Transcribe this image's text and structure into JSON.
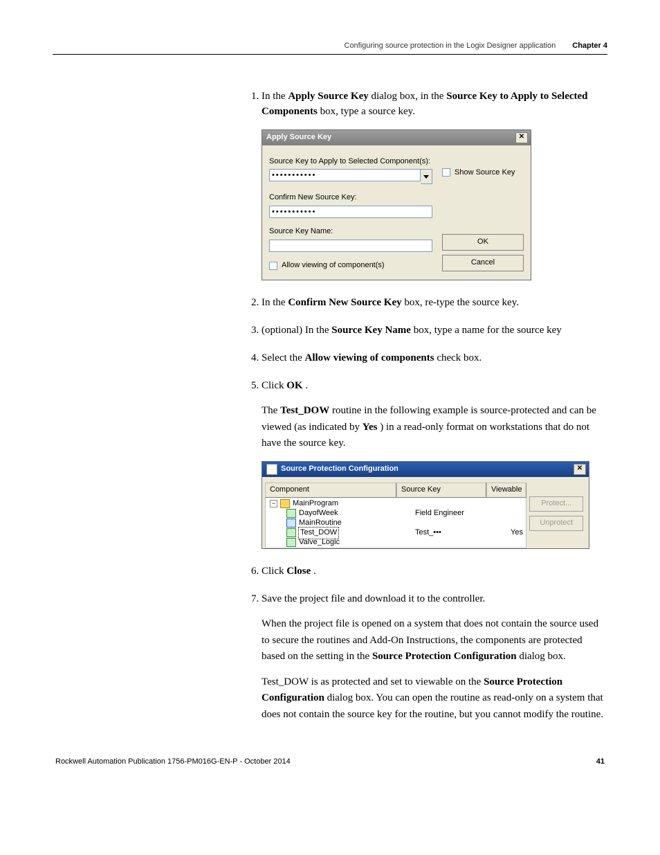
{
  "header": {
    "title": "Configuring source protection in the Logix Designer application",
    "chapter": "Chapter 4"
  },
  "steps": {
    "s1": {
      "pre": "In the ",
      "b1": "Apply Source Key",
      "mid1": " dialog box, in the ",
      "b2": "Source Key to Apply to Selected Components",
      "post": " box, type a source key."
    },
    "s2": {
      "pre": "In the ",
      "b1": "Confirm New Source Key",
      "post": " box, re-type the source key."
    },
    "s3": {
      "pre": "(optional) In the ",
      "b1": "Source Key Name",
      "post": " box, type a name for the source key"
    },
    "s4": {
      "pre": "Select the ",
      "b1": "Allow viewing of components",
      "post": " check box."
    },
    "s5": {
      "pre": "Click ",
      "b1": "OK",
      "post": "."
    },
    "s5f": {
      "t1": "The ",
      "b1": "Test_DOW",
      "t2": " routine in the following example is source-protected and can be viewed (as indicated by ",
      "b2": "Yes",
      "t3": ") in a read-only format on workstations that do not have the source key."
    },
    "s6": {
      "pre": "Click ",
      "b1": "Close",
      "post": "."
    },
    "s7": {
      "line": "Save the project file and download it to the controller.",
      "f1": {
        "t1": "When the project file is opened on a system that does not contain the source used to secure the routines and Add-On Instructions, the components are protected based on the setting in the ",
        "b1": "Source Protection Configuration",
        "t2": " dialog box."
      },
      "f2": {
        "t1": "Test_DOW is as protected and set to viewable on the ",
        "b1": "Source Protection Configuration",
        "t2": " dialog box. You can open the routine as read-only on a system that does not contain the source key for the routine, but you cannot modify the routine."
      }
    }
  },
  "dialog1": {
    "title": "Apply Source Key",
    "close": "✕",
    "lbl_source": "Source Key to Apply to Selected Component(s):",
    "val_source": "•••••••••••",
    "lbl_confirm": "Confirm New Source Key:",
    "val_confirm": "•••••••••••",
    "lbl_name": "Source Key Name:",
    "chk_show": "Show Source Key",
    "btn_ok": "OK",
    "btn_cancel": "Cancel",
    "chk_allow": "Allow viewing of component(s)"
  },
  "dialog2": {
    "title": "Source Protection Configuration",
    "close": "✕",
    "col1": "Component",
    "col2": "Source Key",
    "col3": "Viewable",
    "btn_protect": "Protect...",
    "btn_unprotect": "Unprotect",
    "rows": {
      "r0": {
        "name": "MainProgram",
        "key": "",
        "view": "",
        "toggle": "−"
      },
      "r1": {
        "name": "DayofWeek",
        "key": "Field Engineer",
        "view": ""
      },
      "r2": {
        "name": "MainRoutine",
        "key": "",
        "view": ""
      },
      "r3": {
        "name": "Test_DOW",
        "key": "Test_•••",
        "view": "Yes"
      },
      "r4": {
        "name": "Valve_Logic",
        "key": "",
        "view": ""
      }
    }
  },
  "footer": {
    "pub": "Rockwell Automation Publication 1756-PM016G-EN-P - October 2014",
    "page": "41"
  }
}
